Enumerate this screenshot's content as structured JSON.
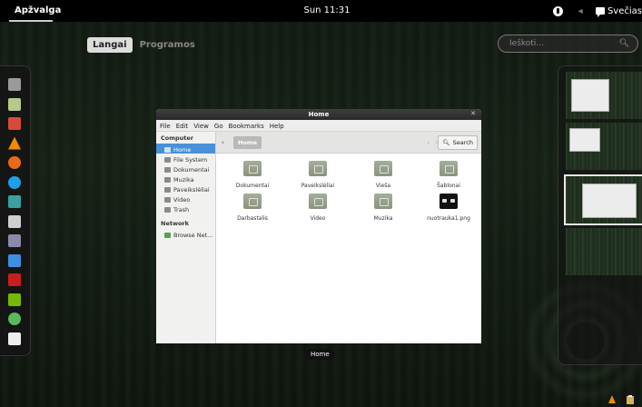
{
  "topbar": {
    "activities_label": "Apžvalga",
    "clock": "Sun 11:31",
    "user_label": "Svečias"
  },
  "overview": {
    "view_tabs": [
      {
        "label": "Langai",
        "active": true
      },
      {
        "label": "Programos",
        "active": false
      }
    ],
    "search_placeholder": "Ieškoti..."
  },
  "dash": {
    "items": [
      {
        "icon": "files-icon",
        "color": "#9a9a9a"
      },
      {
        "icon": "text-editor-icon",
        "color": "#b8c88a"
      },
      {
        "icon": "presentation-icon",
        "color": "#d84b3a"
      },
      {
        "icon": "vlc-icon",
        "color": "#f08a00"
      },
      {
        "icon": "firefox-icon",
        "color": "#e86a1a"
      },
      {
        "icon": "skype-icon",
        "color": "#1ea0e8"
      },
      {
        "icon": "web-browser-icon",
        "color": "#3aa0a0"
      },
      {
        "icon": "network-icon",
        "color": "#cfcfcf"
      },
      {
        "icon": "calendar-icon",
        "color": "#8a8aa8"
      },
      {
        "icon": "dropbox-icon",
        "color": "#3d8fe0"
      },
      {
        "icon": "filezilla-icon",
        "color": "#c81e1e"
      },
      {
        "icon": "nvidia-icon",
        "color": "#76b900"
      },
      {
        "icon": "software-center-icon",
        "color": "#5cb85c"
      },
      {
        "icon": "document-icon",
        "color": "#eeeeee"
      }
    ]
  },
  "window": {
    "title": "Home",
    "caption": "Home",
    "menu": [
      "File",
      "Edit",
      "View",
      "Go",
      "Bookmarks",
      "Help"
    ],
    "sidebar": {
      "computer_heading": "Computer",
      "computer_items": [
        {
          "label": "Home",
          "selected": true
        },
        {
          "label": "File System",
          "selected": false
        },
        {
          "label": "Dokumentai",
          "selected": false
        },
        {
          "label": "Muzika",
          "selected": false
        },
        {
          "label": "Paveikslėliai",
          "selected": false
        },
        {
          "label": "Video",
          "selected": false
        },
        {
          "label": "Trash",
          "selected": false
        }
      ],
      "network_heading": "Network",
      "network_items": [
        {
          "label": "Browse Net..."
        }
      ]
    },
    "toolbar": {
      "breadcrumb": "Home",
      "search_label": "Search"
    },
    "files": [
      {
        "name": "Dokumentai",
        "type": "folder"
      },
      {
        "name": "Paveikslėliai",
        "type": "folder"
      },
      {
        "name": "Vieša",
        "type": "folder"
      },
      {
        "name": "Šablonai",
        "type": "folder"
      },
      {
        "name": "Darbastalis",
        "type": "folder"
      },
      {
        "name": "Video",
        "type": "folder"
      },
      {
        "name": "Muzika",
        "type": "folder"
      },
      {
        "name": "nuotrauka1.png",
        "type": "image"
      }
    ]
  }
}
